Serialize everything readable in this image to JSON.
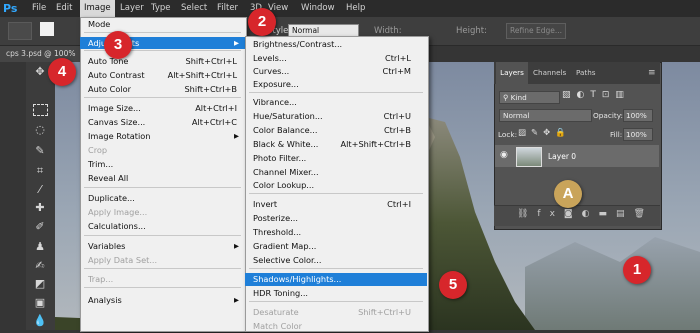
{
  "menubar": {
    "logo": "Ps",
    "items": [
      "File",
      "Edit",
      "Image",
      "Layer",
      "Type",
      "Select",
      "Filter",
      "3D",
      "View",
      "Window",
      "Help"
    ]
  },
  "options_bar": {
    "style_label": "Style:",
    "style_value": "Normal",
    "width_label": "Width:",
    "height_label": "Height:",
    "refine_edge": "Refine Edge..."
  },
  "doc_tab": {
    "label": "cps 3.psd @ 100%"
  },
  "image_menu": [
    {
      "label": "Mode",
      "shortcut": "",
      "disabled": false
    },
    {
      "label": "Adjustments",
      "shortcut": "",
      "disabled": false,
      "highlighted": true,
      "submenu": true
    },
    {
      "label": "Auto Tone",
      "shortcut": "Shift+Ctrl+L",
      "disabled": false
    },
    {
      "label": "Auto Contrast",
      "shortcut": "Alt+Shift+Ctrl+L",
      "disabled": false
    },
    {
      "label": "Auto Color",
      "shortcut": "Shift+Ctrl+B",
      "disabled": false
    },
    {
      "label": "Image Size...",
      "shortcut": "Alt+Ctrl+I",
      "disabled": false
    },
    {
      "label": "Canvas Size...",
      "shortcut": "Alt+Ctrl+C",
      "disabled": false
    },
    {
      "label": "Image Rotation",
      "shortcut": "",
      "disabled": false,
      "submenu": true
    },
    {
      "label": "Crop",
      "shortcut": "",
      "disabled": true
    },
    {
      "label": "Trim...",
      "shortcut": "",
      "disabled": false
    },
    {
      "label": "Reveal All",
      "shortcut": "",
      "disabled": false
    },
    {
      "label": "Duplicate...",
      "shortcut": "",
      "disabled": false
    },
    {
      "label": "Apply Image...",
      "shortcut": "",
      "disabled": true
    },
    {
      "label": "Calculations...",
      "shortcut": "",
      "disabled": false
    },
    {
      "label": "Variables",
      "shortcut": "",
      "disabled": false,
      "submenu": true
    },
    {
      "label": "Apply Data Set...",
      "shortcut": "",
      "disabled": true
    },
    {
      "label": "Trap...",
      "shortcut": "",
      "disabled": true
    },
    {
      "label": "Analysis",
      "shortcut": "",
      "disabled": false,
      "submenu": true
    }
  ],
  "adjustments_menu": [
    {
      "label": "Brightness/Contrast...",
      "shortcut": ""
    },
    {
      "label": "Levels...",
      "shortcut": "Ctrl+L"
    },
    {
      "label": "Curves...",
      "shortcut": "Ctrl+M"
    },
    {
      "label": "Exposure...",
      "shortcut": ""
    },
    {
      "label": "Vibrance...",
      "shortcut": ""
    },
    {
      "label": "Hue/Saturation...",
      "shortcut": "Ctrl+U"
    },
    {
      "label": "Color Balance...",
      "shortcut": "Ctrl+B"
    },
    {
      "label": "Black & White...",
      "shortcut": "Alt+Shift+Ctrl+B"
    },
    {
      "label": "Photo Filter...",
      "shortcut": ""
    },
    {
      "label": "Channel Mixer...",
      "shortcut": ""
    },
    {
      "label": "Color Lookup...",
      "shortcut": ""
    },
    {
      "label": "Invert",
      "shortcut": "Ctrl+I"
    },
    {
      "label": "Posterize...",
      "shortcut": ""
    },
    {
      "label": "Threshold...",
      "shortcut": ""
    },
    {
      "label": "Gradient Map...",
      "shortcut": ""
    },
    {
      "label": "Selective Color...",
      "shortcut": ""
    },
    {
      "label": "Shadows/Highlights...",
      "shortcut": "",
      "highlighted": true
    },
    {
      "label": "HDR Toning...",
      "shortcut": ""
    },
    {
      "label": "Desaturate",
      "shortcut": "Shift+Ctrl+U",
      "disabled": true
    },
    {
      "label": "Match Color",
      "shortcut": "",
      "disabled": true
    }
  ],
  "layers_panel": {
    "tabs": [
      "Layers",
      "Channels",
      "Paths"
    ],
    "kind": "Kind",
    "blend_mode": "Normal",
    "opacity_label": "Opacity:",
    "opacity_value": "100%",
    "lock_label": "Lock:",
    "fill_label": "Fill:",
    "fill_value": "100%",
    "layer_name": "Layer 0"
  },
  "callouts": {
    "c1": "1",
    "c2": "2",
    "c3": "3",
    "c4": "4",
    "c5": "5",
    "cA": "A",
    "red": "#d7262b",
    "gold": "#c9a45a"
  }
}
